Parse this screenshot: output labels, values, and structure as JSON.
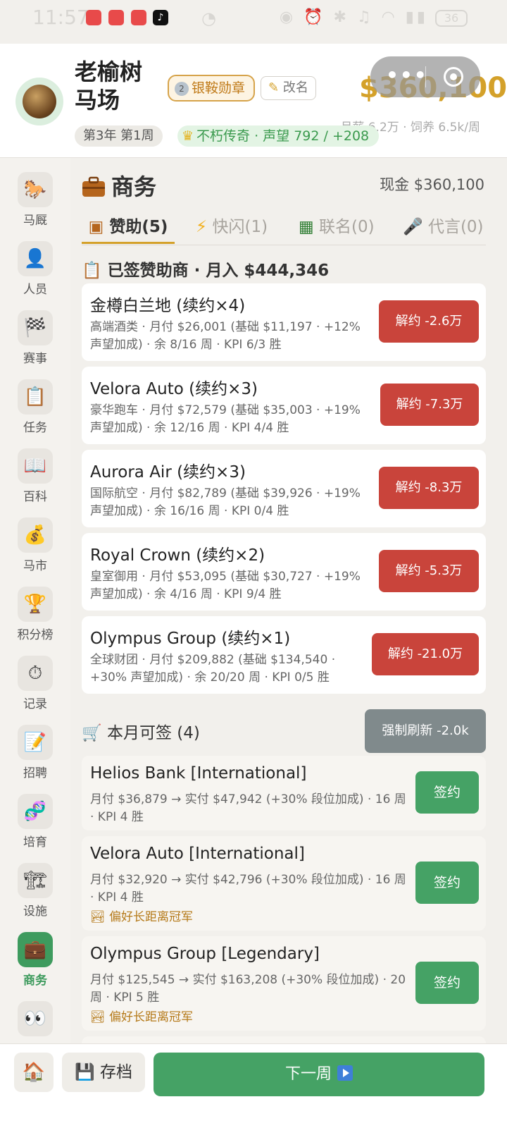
{
  "status_bar": {
    "time": "11:57",
    "battery": "36"
  },
  "header": {
    "farm_name": "老榆树马场",
    "medal_num": "2",
    "medal_label": "银鞍勋章",
    "rename_label": "改名",
    "money": "$360,100",
    "salary": "月薪 6.2万 · 饲养 6.5k/周",
    "week": "第3年 第1周",
    "legend": "不朽传奇 · 声望 792 / +208"
  },
  "sidebar": {
    "items": [
      {
        "label": "马厩",
        "icon": "horse-icon",
        "glyph": "🐎"
      },
      {
        "label": "人员",
        "icon": "person-icon",
        "glyph": "👤"
      },
      {
        "label": "赛事",
        "icon": "checkered-flag-icon",
        "glyph": "🏁"
      },
      {
        "label": "任务",
        "icon": "clipboard-icon",
        "glyph": "📋"
      },
      {
        "label": "百科",
        "icon": "book-icon",
        "glyph": "📖"
      },
      {
        "label": "马市",
        "icon": "money-bag-icon",
        "glyph": "💰"
      },
      {
        "label": "积分榜",
        "icon": "trophy-icon",
        "glyph": "🏆"
      },
      {
        "label": "记录",
        "icon": "stopwatch-icon",
        "glyph": "⏱"
      },
      {
        "label": "招聘",
        "icon": "memo-icon",
        "glyph": "📝"
      },
      {
        "label": "培育",
        "icon": "dna-icon",
        "glyph": "🧬"
      },
      {
        "label": "设施",
        "icon": "crane-icon",
        "glyph": "🏗"
      },
      {
        "label": "商务",
        "icon": "briefcase-icon",
        "glyph": "💼"
      },
      {
        "label": "",
        "icon": "eyes-icon",
        "glyph": "👀"
      }
    ]
  },
  "business": {
    "title": "商务",
    "cash": "现金 $360,100",
    "tabs": [
      {
        "label": "赞助(5)",
        "icon": "briefcase-icon"
      },
      {
        "label": "快闪(1)",
        "icon": "lightning-icon"
      },
      {
        "label": "联名(0)",
        "icon": "clapper-icon"
      },
      {
        "label": "代言(0)",
        "icon": "microphone-icon"
      }
    ],
    "signed_title": "已签赞助商 · 月入 $444,346",
    "signed": [
      {
        "name": "金樽白兰地 (续约×4)",
        "desc": "高端酒类 · 月付 $26,001 (基础 $11,197 · +12% 声望加成) · 余 8/16 周 · KPI 6/3 胜",
        "action": "解约 -2.6万"
      },
      {
        "name": "Velora Auto (续约×3)",
        "desc": "豪华跑车 · 月付 $72,579 (基础 $35,003 · +19% 声望加成) · 余 12/16 周 · KPI 4/4 胜",
        "action": "解约 -7.3万"
      },
      {
        "name": "Aurora Air (续约×3)",
        "desc": "国际航空 · 月付 $82,789 (基础 $39,926 · +19% 声望加成) · 余 16/16 周 · KPI 0/4 胜",
        "action": "解约 -8.3万"
      },
      {
        "name": "Royal Crown (续约×2)",
        "desc": "皇室御用 · 月付 $53,095 (基础 $30,727 · +19% 声望加成) · 余 4/16 周 · KPI 9/4 胜",
        "action": "解约 -5.3万"
      },
      {
        "name": "Olympus Group (续约×1)",
        "desc": "全球财团 · 月付 $209,882 (基础 $134,540 · +30% 声望加成) · 余 20/20 周 · KPI 0/5 胜",
        "action": "解约 -21.0万"
      }
    ],
    "available_title": "本月可签 (4)",
    "refresh_label": "强制刷新 -2.0k",
    "available": [
      {
        "name": "Helios Bank [International]",
        "desc": "月付 $36,879 → 实付 $47,942 (+30% 段位加成) · 16 周 · KPI 4 胜",
        "pref": "",
        "action": "签约"
      },
      {
        "name": "Velora Auto [International]",
        "desc": "月付 $32,920 → 实付 $42,796 (+30% 段位加成) · 16 周 · KPI 4 胜",
        "pref": "偏好长距离冠军",
        "action": "签约"
      },
      {
        "name": "Olympus Group [Legendary]",
        "desc": "月付 $125,545 → 实付 $163,208 (+30% 段位加成) · 20 周 · KPI 5 胜",
        "pref": "偏好长距离冠军",
        "action": "签约"
      }
    ]
  },
  "bottom": {
    "home_icon": "house-icon",
    "save_label": "存档",
    "next_label": "下一周"
  },
  "colors": {
    "accent_gold": "#d4a12a",
    "terminate_red": "#c9443b",
    "sign_green": "#45a265",
    "refresh_gray": "#808a8c"
  }
}
